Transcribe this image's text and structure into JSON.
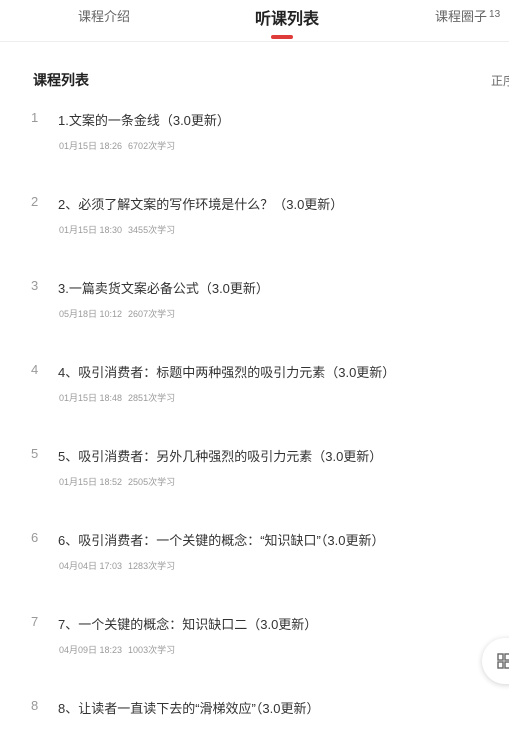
{
  "tabs": [
    {
      "label": "课程介绍",
      "badge": ""
    },
    {
      "label": "听课列表",
      "badge": ""
    },
    {
      "label": "课程圈子",
      "badge": "13"
    }
  ],
  "section": {
    "title": "课程列表",
    "right_text": "正序"
  },
  "lessons": [
    {
      "index": "1",
      "title": "1.文案的一条金线（3.0更新）",
      "date": "01月15日 18:26",
      "views": "6702次学习"
    },
    {
      "index": "2",
      "title": "2、必须了解文案的写作环境是什么？（3.0更新）",
      "date": "01月15日 18:30",
      "views": "3455次学习"
    },
    {
      "index": "3",
      "title": "3.一篇卖货文案必备公式（3.0更新）",
      "date": "05月18日 10:12",
      "views": "2607次学习"
    },
    {
      "index": "4",
      "title": "4、吸引消费者：标题中两种强烈的吸引力元素（3.0更新）",
      "date": "01月15日 18:48",
      "views": "2851次学习"
    },
    {
      "index": "5",
      "title": "5、吸引消费者：另外几种强烈的吸引力元素（3.0更新）",
      "date": "01月15日 18:52",
      "views": "2505次学习"
    },
    {
      "index": "6",
      "title": "6、吸引消费者：一个关键的概念：“知识缺口”（3.0更新）",
      "date": "04月04日 17:03",
      "views": "1283次学习"
    },
    {
      "index": "7",
      "title": "7、一个关键的概念：知识缺口二（3.0更新）",
      "date": "04月09日 18:23",
      "views": "1003次学习"
    },
    {
      "index": "8",
      "title": "8、让读者一直读下去的“滑梯效应”（3.0更新）",
      "date": "",
      "views": ""
    }
  ],
  "icons": {
    "float_button": "grid-icon"
  },
  "colors": {
    "accent": "#e03b3b"
  }
}
